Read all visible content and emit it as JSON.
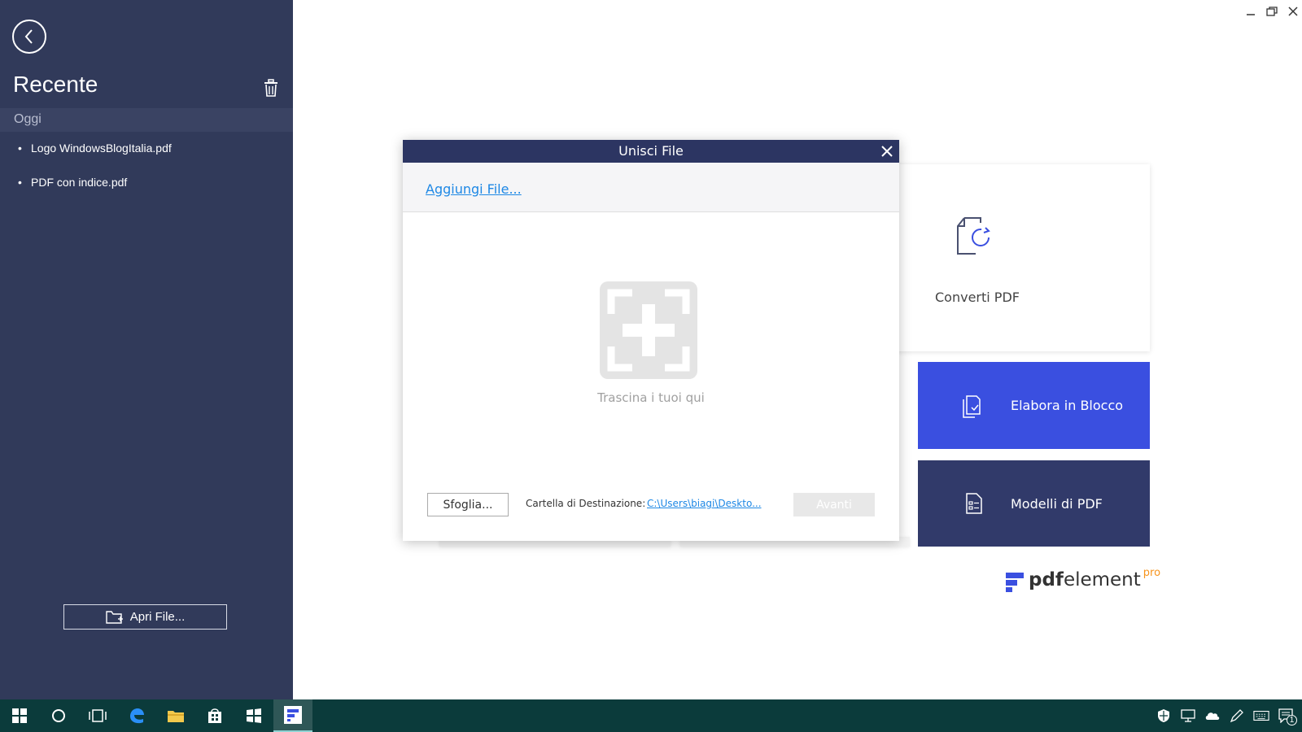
{
  "sidebar": {
    "title": "Recente",
    "group_today": "Oggi",
    "recent_files": [
      {
        "name": "Logo WindowsBlogItalia.pdf"
      },
      {
        "name": "PDF con indice.pdf"
      }
    ],
    "open_file_label": "Apri File..."
  },
  "tiles": {
    "convert_label": "Converti PDF",
    "batch_label": "Elabora in Blocco",
    "templates_label": "Modelli di PDF"
  },
  "logo": {
    "text_bold": "pdf",
    "text_regular": "element",
    "badge": "pro"
  },
  "dialog": {
    "title": "Unisci File",
    "add_files_link": "Aggiungi File...",
    "drop_hint": "Trascina i tuoi qui",
    "browse_label": "Sfoglia...",
    "destination_label": "Cartella di Destinazione:",
    "destination_path": "C:\\Users\\biagi\\Deskto...",
    "next_label": "Avanti"
  },
  "taskbar": {
    "tray_notification_count": "1"
  },
  "colors": {
    "sidebar_bg": "#313a5a",
    "dialog_titlebar": "#2c3562",
    "batch_tile": "#3a4fe0",
    "templates_tile": "#313a6a",
    "link": "#1e88e5",
    "taskbar_bg": "#0b3b3b"
  }
}
